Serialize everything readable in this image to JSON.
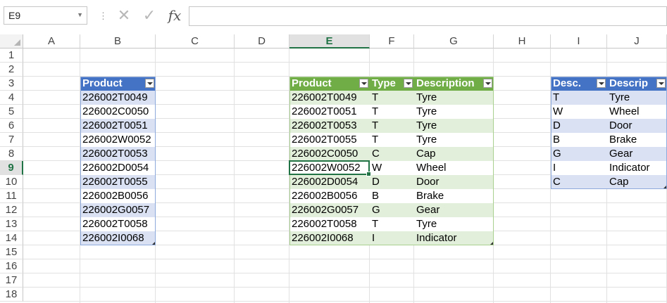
{
  "formula_bar": {
    "name_box": "E9",
    "formula": "",
    "cancel_glyph": "✕",
    "enter_glyph": "✓",
    "fx_label": "fx"
  },
  "active_cell": "E9",
  "columns": [
    "A",
    "B",
    "C",
    "D",
    "E",
    "F",
    "G",
    "H",
    "I",
    "J"
  ],
  "rows": [
    "1",
    "2",
    "3",
    "4",
    "5",
    "6",
    "7",
    "8",
    "9",
    "10",
    "11",
    "12",
    "13",
    "14",
    "15",
    "16",
    "17",
    "18"
  ],
  "colors": {
    "blue_header": "#4472c4",
    "blue_band": "#d9e1f2",
    "green_header": "#70ad47",
    "green_band": "#e2efda",
    "selection_green": "#217346"
  },
  "table_products": {
    "header": "Product",
    "rows": [
      "226002T0049",
      "226002C0050",
      "226002T0051",
      "226002W0052",
      "226002T0053",
      "226002D0054",
      "226002T0055",
      "226002B0056",
      "226002G0057",
      "226002T0058",
      "226002I0068"
    ]
  },
  "table_lookup": {
    "headers": [
      "Product",
      "Type",
      "Description"
    ],
    "rows": [
      [
        "226002T0049",
        "T",
        "Tyre"
      ],
      [
        "226002T0051",
        "T",
        "Tyre"
      ],
      [
        "226002T0053",
        "T",
        "Tyre"
      ],
      [
        "226002T0055",
        "T",
        "Tyre"
      ],
      [
        "226002C0050",
        "C",
        "Cap"
      ],
      [
        "226002W0052",
        "W",
        "Wheel"
      ],
      [
        "226002D0054",
        "D",
        "Door"
      ],
      [
        "226002B0056",
        "B",
        "Brake"
      ],
      [
        "226002G0057",
        "G",
        "Gear"
      ],
      [
        "226002T0058",
        "T",
        "Tyre"
      ],
      [
        "226002I0068",
        "I",
        "Indicator"
      ]
    ]
  },
  "table_desc": {
    "headers": [
      "Desc.",
      "Descrip"
    ],
    "rows": [
      [
        "T",
        "Tyre"
      ],
      [
        "W",
        "Wheel"
      ],
      [
        "D",
        "Door"
      ],
      [
        "B",
        "Brake"
      ],
      [
        "G",
        "Gear"
      ],
      [
        "I",
        "Indicator"
      ],
      [
        "C",
        "Cap"
      ]
    ]
  }
}
